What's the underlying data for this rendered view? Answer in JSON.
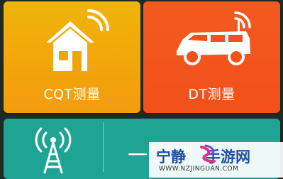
{
  "tiles": {
    "cqt": {
      "label": "CQT测量",
      "icon": "house-wifi-icon",
      "color": "#f2a50a"
    },
    "dt": {
      "label": "DT测量",
      "icon": "van-wifi-icon",
      "color": "#f3501c"
    },
    "bottom": {
      "text": "一键测",
      "icon": "antenna-tower-icon",
      "color": "#1fa493"
    }
  },
  "watermark": {
    "left_text": "宁静",
    "right_text": "手游网",
    "url": "WWW.NZJINGUAN.COM"
  }
}
